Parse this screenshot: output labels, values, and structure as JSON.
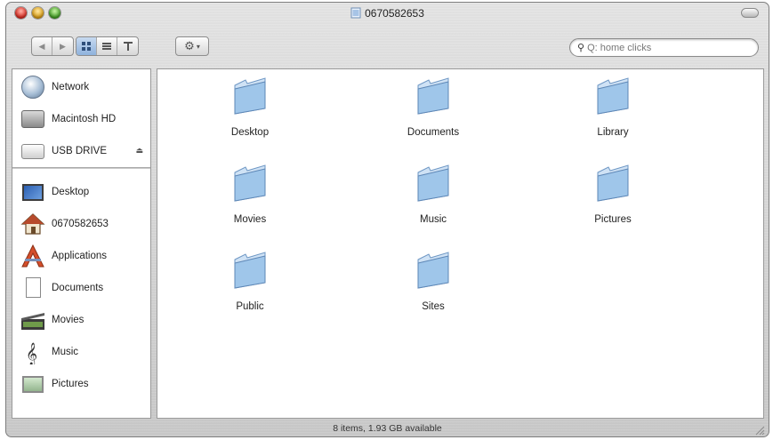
{
  "window": {
    "title": "0670582653"
  },
  "toolbar": {
    "back_icon": "back-arrow-icon",
    "forward_icon": "forward-arrow-icon",
    "view_icons": [
      "icon-view-icon",
      "list-view-icon",
      "column-view-icon"
    ],
    "action_icon": "gear-icon",
    "search_placeholder": "Q: home clicks"
  },
  "sidebar": {
    "items": [
      {
        "label": "Network",
        "icon": "network-globe-icon"
      },
      {
        "label": "Macintosh HD",
        "icon": "hard-drive-icon"
      },
      {
        "label": "USB DRIVE",
        "icon": "usb-drive-icon",
        "eject": "⏏"
      },
      {
        "label": "Desktop",
        "icon": "desktop-icon"
      },
      {
        "label": "0670582653",
        "icon": "home-icon"
      },
      {
        "label": "Applications",
        "icon": "applications-icon"
      },
      {
        "label": "Documents",
        "icon": "documents-icon"
      },
      {
        "label": "Movies",
        "icon": "movies-icon"
      },
      {
        "label": "Music",
        "icon": "music-icon"
      },
      {
        "label": "Pictures",
        "icon": "pictures-icon"
      }
    ]
  },
  "content": {
    "folders": [
      {
        "label": "Desktop"
      },
      {
        "label": "Documents"
      },
      {
        "label": "Library"
      },
      {
        "label": "Movies"
      },
      {
        "label": "Music"
      },
      {
        "label": "Pictures"
      },
      {
        "label": "Public"
      },
      {
        "label": "Sites"
      }
    ]
  },
  "status": {
    "text": "8 items, 1.93 GB available"
  },
  "colors": {
    "folder_blue": "#9fc6ea",
    "selection_blue": "#8fb2dc",
    "window_metal": "#d2d2d2"
  }
}
